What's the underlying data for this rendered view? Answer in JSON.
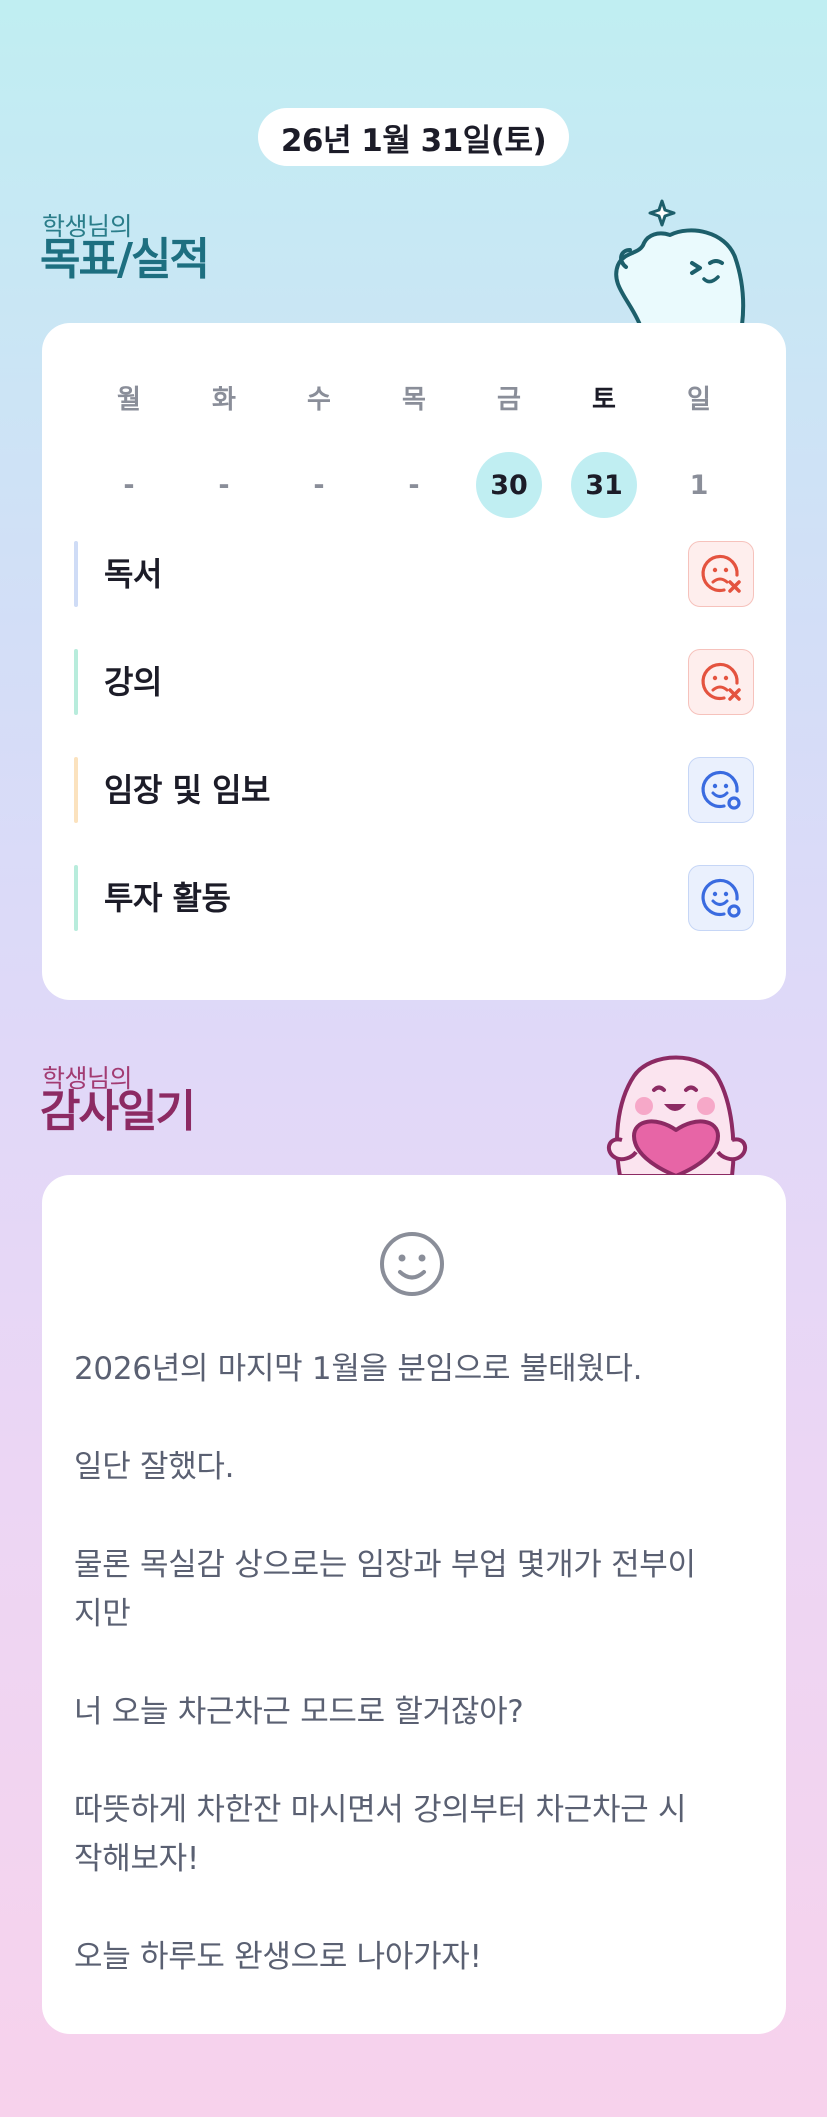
{
  "header": {
    "date": "26년 1월 31일(토)"
  },
  "goals_section": {
    "small_title": "학생님의",
    "big_title": "목표/실적"
  },
  "week": [
    {
      "weekday": "월",
      "date": "-",
      "filled": false,
      "today": false
    },
    {
      "weekday": "화",
      "date": "-",
      "filled": false,
      "today": false
    },
    {
      "weekday": "수",
      "date": "-",
      "filled": false,
      "today": false
    },
    {
      "weekday": "목",
      "date": "-",
      "filled": false,
      "today": false
    },
    {
      "weekday": "금",
      "date": "30",
      "filled": true,
      "today": false
    },
    {
      "weekday": "토",
      "date": "31",
      "filled": true,
      "today": true
    },
    {
      "weekday": "일",
      "date": "1",
      "filled": false,
      "today": false
    }
  ],
  "goals": [
    {
      "label": "독서",
      "bar_color": "#cfdcf6",
      "status": "fail",
      "status_icon": "sad-face-x-icon"
    },
    {
      "label": "강의",
      "bar_color": "#b8ecdc",
      "status": "fail",
      "status_icon": "sad-face-x-icon"
    },
    {
      "label": "임장 및 임보",
      "bar_color": "#fbe2be",
      "status": "done",
      "status_icon": "smile-face-o-icon"
    },
    {
      "label": "투자 활동",
      "bar_color": "#b8ecdc",
      "status": "done",
      "status_icon": "smile-face-o-icon"
    }
  ],
  "diary_section": {
    "small_title": "학생님의",
    "big_title": "감사일기"
  },
  "diary": {
    "mood_icon": "smiley-icon",
    "text": "2026년의 마지막 1월을 분임으로 불태웠다.\n\n일단 잘했다.\n\n물론 목실감 상으로는 임장과 부업 몇개가 전부이\n지만\n\n너 오늘 차근차근 모드로 할거잖아?\n\n따뜻하게 차한잔 마시면서 강의부터 차근차근 시\n작해보자!\n\n오늘 하루도 완생으로 나아가자!"
  },
  "colors": {
    "fail": "#e4533f",
    "done": "#3a6be0",
    "today_fill": "#c0eef2"
  }
}
